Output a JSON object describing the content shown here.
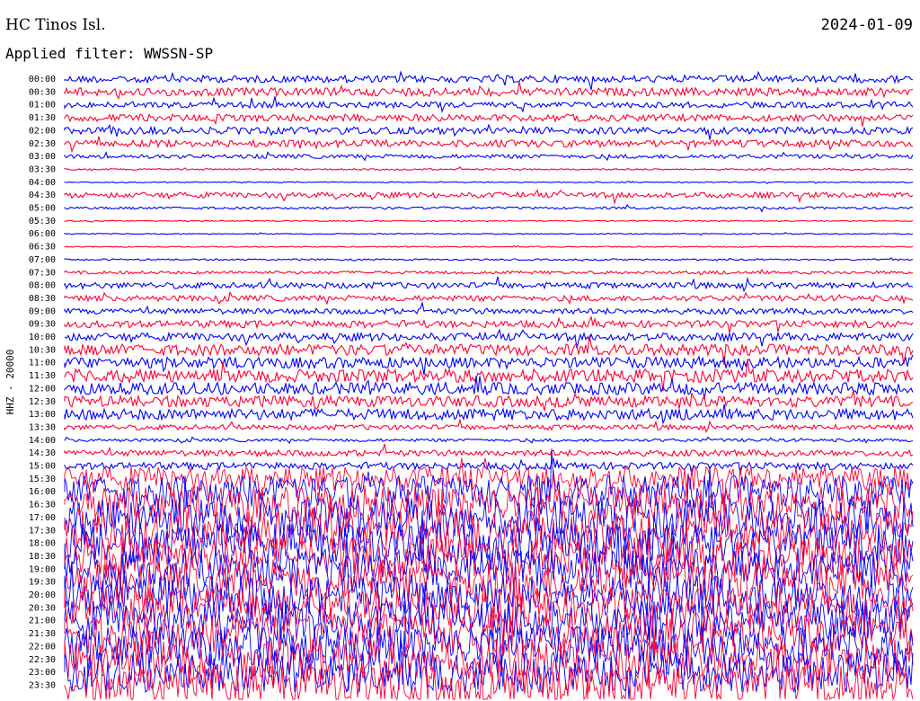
{
  "header": {
    "station": "HC Tinos Isl.",
    "date": "2024-01-09",
    "filter": "Applied filter: WWSSN-SP"
  },
  "chart_data": {
    "type": "line",
    "title": "HC Tinos Isl.",
    "ylabel": "HHZ - 20000",
    "series_colors": [
      "#0000ff",
      "#ff0033"
    ],
    "traces": [
      {
        "label": "00:00",
        "amplitude": 0.35
      },
      {
        "label": "00:30",
        "amplitude": 0.4
      },
      {
        "label": "01:00",
        "amplitude": 0.3
      },
      {
        "label": "01:30",
        "amplitude": 0.35
      },
      {
        "label": "02:00",
        "amplitude": 0.35
      },
      {
        "label": "02:30",
        "amplitude": 0.35
      },
      {
        "label": "03:00",
        "amplitude": 0.2
      },
      {
        "label": "03:30",
        "amplitude": 0.08
      },
      {
        "label": "04:00",
        "amplitude": 0.05
      },
      {
        "label": "04:30",
        "amplitude": 0.28
      },
      {
        "label": "05:00",
        "amplitude": 0.12
      },
      {
        "label": "05:30",
        "amplitude": 0.05
      },
      {
        "label": "06:00",
        "amplitude": 0.05
      },
      {
        "label": "06:30",
        "amplitude": 0.05
      },
      {
        "label": "07:00",
        "amplitude": 0.08
      },
      {
        "label": "07:30",
        "amplitude": 0.15
      },
      {
        "label": "08:00",
        "amplitude": 0.3
      },
      {
        "label": "08:30",
        "amplitude": 0.28
      },
      {
        "label": "09:00",
        "amplitude": 0.28
      },
      {
        "label": "09:30",
        "amplitude": 0.35
      },
      {
        "label": "10:00",
        "amplitude": 0.4
      },
      {
        "label": "10:30",
        "amplitude": 0.55
      },
      {
        "label": "11:00",
        "amplitude": 0.55
      },
      {
        "label": "11:30",
        "amplitude": 0.65
      },
      {
        "label": "12:00",
        "amplitude": 0.6
      },
      {
        "label": "12:30",
        "amplitude": 0.55
      },
      {
        "label": "13:00",
        "amplitude": 0.55
      },
      {
        "label": "13:30",
        "amplitude": 0.25
      },
      {
        "label": "14:00",
        "amplitude": 0.15
      },
      {
        "label": "14:30",
        "amplitude": 0.3
      },
      {
        "label": "15:00",
        "amplitude": 0.35
      },
      {
        "label": "15:30",
        "amplitude": 1.2
      },
      {
        "label": "16:00",
        "amplitude": 1.6
      },
      {
        "label": "16:30",
        "amplitude": 1.8
      },
      {
        "label": "17:00",
        "amplitude": 2.0
      },
      {
        "label": "17:30",
        "amplitude": 2.0
      },
      {
        "label": "18:00",
        "amplitude": 2.0
      },
      {
        "label": "18:30",
        "amplitude": 2.0
      },
      {
        "label": "19:00",
        "amplitude": 2.0
      },
      {
        "label": "19:30",
        "amplitude": 2.0
      },
      {
        "label": "20:00",
        "amplitude": 2.0
      },
      {
        "label": "20:30",
        "amplitude": 2.0
      },
      {
        "label": "21:00",
        "amplitude": 2.0
      },
      {
        "label": "21:30",
        "amplitude": 2.0
      },
      {
        "label": "22:00",
        "amplitude": 2.0
      },
      {
        "label": "22:30",
        "amplitude": 2.0
      },
      {
        "label": "23:00",
        "amplitude": 2.0
      },
      {
        "label": "23:30",
        "amplitude": 2.0
      }
    ]
  }
}
